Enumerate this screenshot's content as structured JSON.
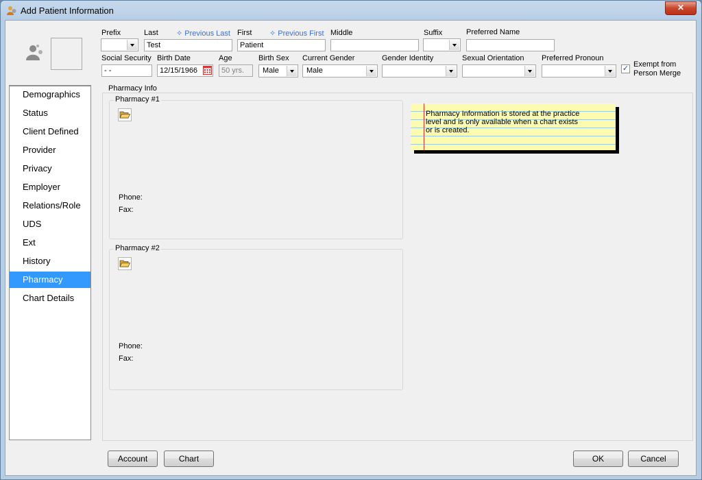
{
  "window": {
    "title": "Add Patient Information",
    "close_glyph": "✕"
  },
  "name_row": {
    "prefix": {
      "label": "Prefix",
      "value": ""
    },
    "last": {
      "label": "Last",
      "value": "Test",
      "previous_link": "✧ Previous Last"
    },
    "first": {
      "label": "First",
      "value": "Patient",
      "previous_link": "✧ Previous First"
    },
    "middle": {
      "label": "Middle",
      "value": ""
    },
    "suffix": {
      "label": "Suffix",
      "value": ""
    },
    "preferred_name": {
      "label": "Preferred Name",
      "value": ""
    }
  },
  "info_row": {
    "ssn": {
      "label": "Social Security",
      "value": "  -  -"
    },
    "birth_date": {
      "label": "Birth Date",
      "value": "12/15/1966"
    },
    "age": {
      "label": "Age",
      "value": "50 yrs."
    },
    "birth_sex": {
      "label": "Birth Sex",
      "value": "Male"
    },
    "current_gender": {
      "label": "Current Gender",
      "value": "Male"
    },
    "gender_identity": {
      "label": "Gender Identity",
      "value": ""
    },
    "sexual_orientation": {
      "label": "Sexual Orientation",
      "value": ""
    },
    "preferred_pronoun": {
      "label": "Preferred Pronoun",
      "value": ""
    },
    "exempt": {
      "label_line1": "Exempt from",
      "label_line2": "Person Merge",
      "checked": true,
      "check_glyph": "✓"
    }
  },
  "sidebar": {
    "items": [
      {
        "label": "Demographics",
        "active": false
      },
      {
        "label": "Status",
        "active": false
      },
      {
        "label": "Client Defined",
        "active": false
      },
      {
        "label": "Provider",
        "active": false
      },
      {
        "label": "Privacy",
        "active": false
      },
      {
        "label": "Employer",
        "active": false
      },
      {
        "label": "Relations/Role",
        "active": false
      },
      {
        "label": "UDS",
        "active": false
      },
      {
        "label": "Ext",
        "active": false
      },
      {
        "label": "History",
        "active": false
      },
      {
        "label": "Pharmacy",
        "active": true
      },
      {
        "label": "Chart Details",
        "active": false
      }
    ]
  },
  "pharmacy": {
    "section_title": "Pharmacy Info",
    "pharmacy1": {
      "title": "Pharmacy #1",
      "phone_label": "Phone:",
      "fax_label": "Fax:"
    },
    "pharmacy2": {
      "title": "Pharmacy #2",
      "phone_label": "Phone:",
      "fax_label": "Fax:"
    },
    "note": "Pharmacy Information is stored at the practice level and is only available when a chart exists or is created."
  },
  "buttons": {
    "account": "Account",
    "chart": "Chart",
    "ok": "OK",
    "cancel": "Cancel"
  },
  "colors": {
    "selected": "#3399ff",
    "link": "#3a6fd8",
    "note_bg": "#fdfbb0"
  }
}
